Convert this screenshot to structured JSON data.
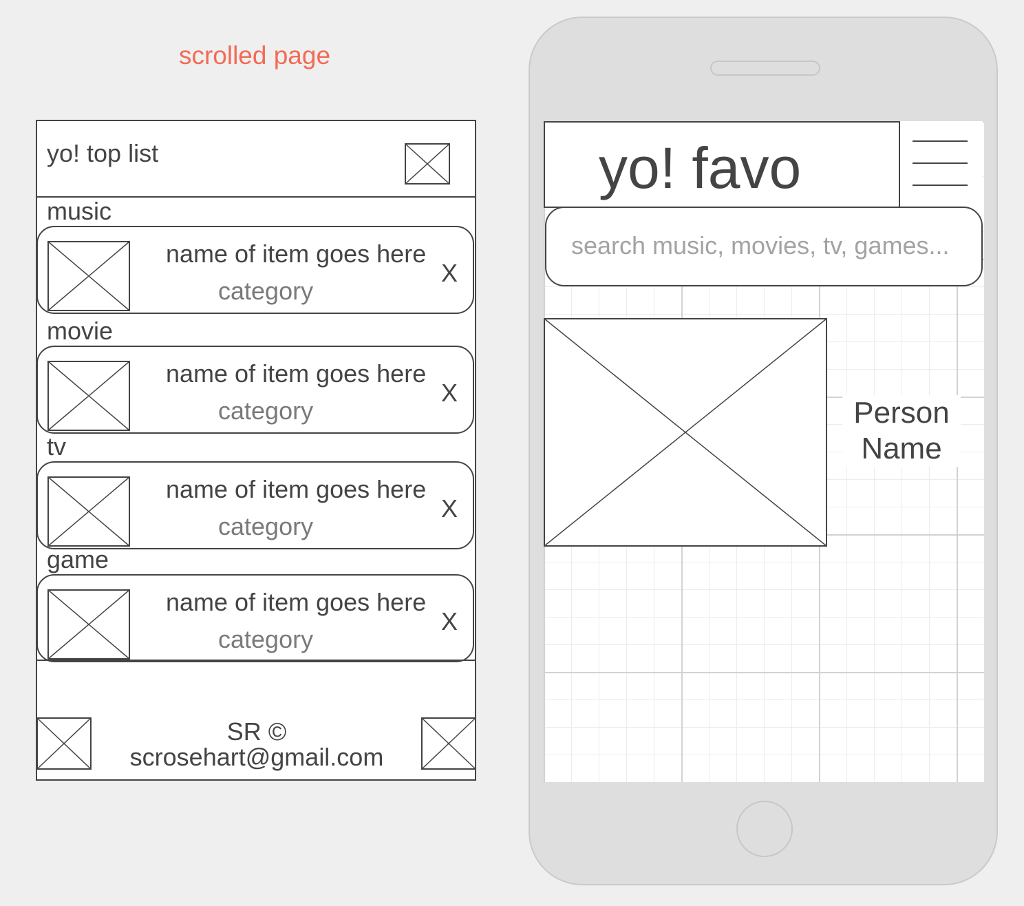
{
  "caption": "scrolled page",
  "left_page": {
    "header": {
      "title": "yo! top list",
      "icon": "image-placeholder-icon"
    },
    "sections": [
      {
        "label": "music",
        "item": {
          "name": "name of item goes here",
          "category": "category",
          "remove": "X"
        }
      },
      {
        "label": "movie",
        "item": {
          "name": "name of item goes here",
          "category": "category",
          "remove": "X"
        }
      },
      {
        "label": "tv",
        "item": {
          "name": "name of item goes here",
          "category": "category",
          "remove": "X"
        }
      },
      {
        "label": "game",
        "item": {
          "name": "name of item goes here",
          "category": "category",
          "remove": "X"
        }
      }
    ],
    "footer": {
      "line1": "SR ©",
      "line2": "scrosehart@gmail.com"
    }
  },
  "phone": {
    "app_title": "yo! favo",
    "menu_icon": "hamburger-menu-icon",
    "search_placeholder": "search music, movies, tv, games...",
    "profile": {
      "name_line1": "Person",
      "name_line2": "Name"
    }
  },
  "colors": {
    "caption": "#f26b55",
    "stroke": "#444444",
    "phone_body": "#dedede",
    "placeholder_text": "#a3a3a3",
    "category_text": "#7a7a7a"
  }
}
